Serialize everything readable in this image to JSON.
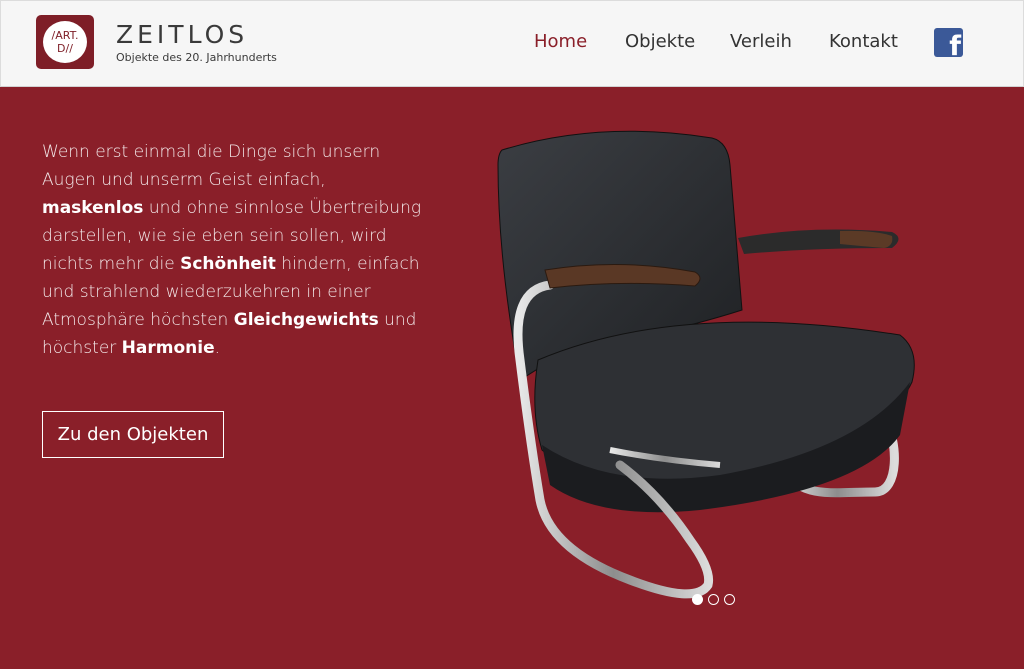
{
  "brand": {
    "logo_line1": "/ART.",
    "logo_line2": "D//",
    "name": "ZEITLOS",
    "tagline": "Objekte des 20. Jahrhunderts"
  },
  "nav": {
    "items": [
      {
        "label": "Home",
        "active": true
      },
      {
        "label": "Objekte",
        "active": false
      },
      {
        "label": "Verleih",
        "active": false
      },
      {
        "label": "Kontakt",
        "active": false
      }
    ],
    "social_icon": "facebook-icon",
    "social_glyph": "f"
  },
  "hero": {
    "p1": "Wenn erst einmal die Dinge sich unsern Augen und unserm Geist einfach, ",
    "b1": "maskenlos",
    "p2": " und ohne sinnlose Übertreibung darstellen, wie sie eben sein sollen, wird nichts mehr die ",
    "b2": "Schönheit",
    "p3": " hindern, einfach und strahlend wiederzukehren in einer Atmosphäre höchsten ",
    "b3": "Gleichgewichts",
    "p4": " und höchster ",
    "b4": "Harmonie",
    "p5": ".",
    "button_label": "Zu den Objekten"
  },
  "slider": {
    "image": "lounge-chair",
    "slide_count": 3,
    "active_slide": 1
  },
  "colors": {
    "accent": "#8a1f29",
    "header_bg": "#f6f6f6",
    "facebook": "#3b5998"
  }
}
